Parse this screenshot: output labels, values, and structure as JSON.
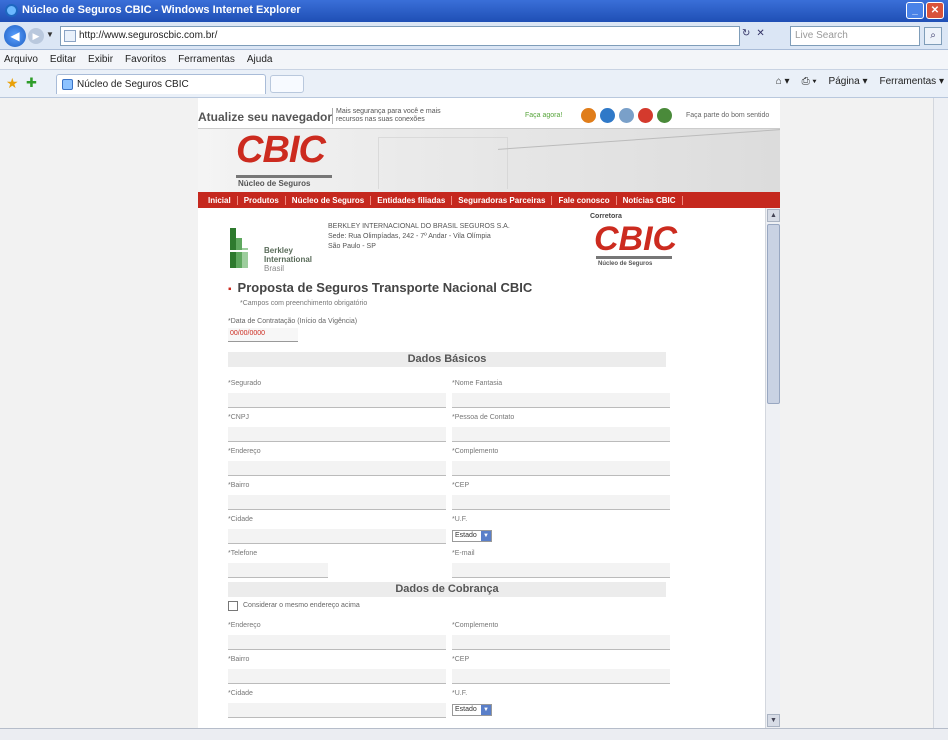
{
  "window": {
    "title": "Núcleo de Seguros CBIC - Windows Internet Explorer"
  },
  "address_bar": {
    "url": "http://www.seguroscbic.com.br/",
    "search_placeholder": "Live Search"
  },
  "menu": [
    "Arquivo",
    "Editar",
    "Exibir",
    "Favoritos",
    "Ferramentas",
    "Ajuda"
  ],
  "tab": {
    "title": "Núcleo de Seguros CBIC"
  },
  "toolbar": {
    "page_label": "Página",
    "tools_label": "Ferramentas"
  },
  "site": {
    "upgrade_title": "Atualize seu navegador",
    "upgrade_text": "Mais segurança para você e mais recursos nas suas conexões",
    "download_label": "Faça agora!",
    "support_text": "Faça parte do bom sentido",
    "logo": "CBIC",
    "logo_sub": "Núcleo de Seguros",
    "nav": [
      "Inicial",
      "Produtos",
      "Núcleo de Seguros",
      "Entidades filiadas",
      "Seguradoras Parceiras",
      "Fale conosco",
      "Notícias CBIC"
    ]
  },
  "form": {
    "insurer_name_line1": "Berkley",
    "insurer_name_line2": "International",
    "insurer_name_line3": "Brasil",
    "company_name": "BERKLEY INTERNACIONAL DO BRASIL SEGUROS S.A.",
    "company_address": "Sede: Rua Olimpíadas, 242 - 7º Andar - Vila Olímpia",
    "company_city": "São Paulo - SP",
    "broker_label": "Corretora",
    "broker_logo": "CBIC",
    "broker_sub": "Núcleo de Seguros",
    "title": "Proposta de Seguros Transporte Nacional CBIC",
    "mandatory_note": "*Campos com preenchimento obrigatório",
    "date_label": "*Data de Contratação (Início da Vigência)",
    "date_value": "00/00/0000",
    "section_basic": "Dados Básicos",
    "section_billing": "Dados de Cobrança",
    "fields_basic": {
      "segurado": "*Segurado",
      "nome_fantasia": "*Nome Fantasia",
      "cnpj": "*CNPJ",
      "pessoa_contato": "*Pessoa de Contato",
      "endereco": "*Endereço",
      "complemento": "*Complemento",
      "bairro": "*Bairro",
      "cep": "*CEP",
      "cidade": "*Cidade",
      "uf": "*U.F.",
      "telefone": "*Telefone",
      "email": "*E-mail"
    },
    "uf_select": "Estado",
    "same_address_label": "Considerar o mesmo endereço acima",
    "fields_billing": {
      "endereco": "*Endereço",
      "complemento": "*Complemento",
      "bairro": "*Bairro",
      "cep": "*CEP",
      "cidade": "*Cidade",
      "uf": "*U.F."
    }
  }
}
